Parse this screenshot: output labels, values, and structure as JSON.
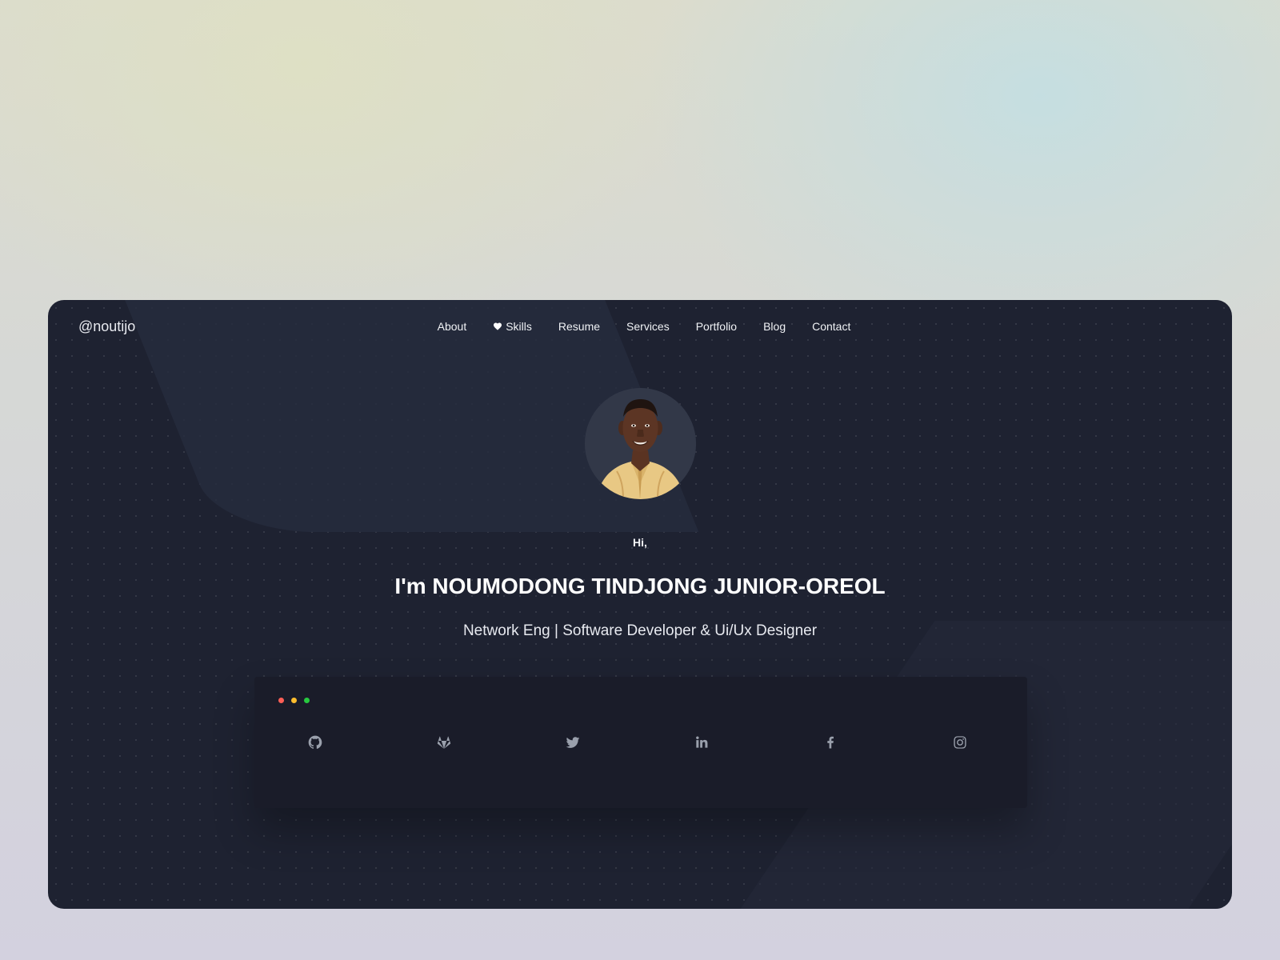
{
  "brand": {
    "handle": "@noutijo"
  },
  "nav": {
    "items": [
      {
        "label": "About"
      },
      {
        "label": "Skills",
        "icon": "heart-icon"
      },
      {
        "label": "Resume"
      },
      {
        "label": "Services"
      },
      {
        "label": "Portfolio"
      },
      {
        "label": "Blog"
      },
      {
        "label": "Contact"
      }
    ]
  },
  "hero": {
    "greeting": "Hi,",
    "headline": "I'm NOUMODONG TINDJONG JUNIOR-OREOL",
    "subtitle": "Network Eng | Software Developer & Ui/Ux Designer"
  },
  "social_links": [
    {
      "name": "github-icon"
    },
    {
      "name": "gitlab-icon"
    },
    {
      "name": "twitter-icon"
    },
    {
      "name": "linkedin-icon"
    },
    {
      "name": "facebook-icon"
    },
    {
      "name": "instagram-icon"
    }
  ],
  "colors": {
    "card_background": "#1e2231",
    "terminal_background": "#1a1c29",
    "icon_color": "#9aa0ac",
    "dot_red": "#ff5f56",
    "dot_yellow": "#ffbd2e",
    "dot_green": "#27c93f"
  }
}
